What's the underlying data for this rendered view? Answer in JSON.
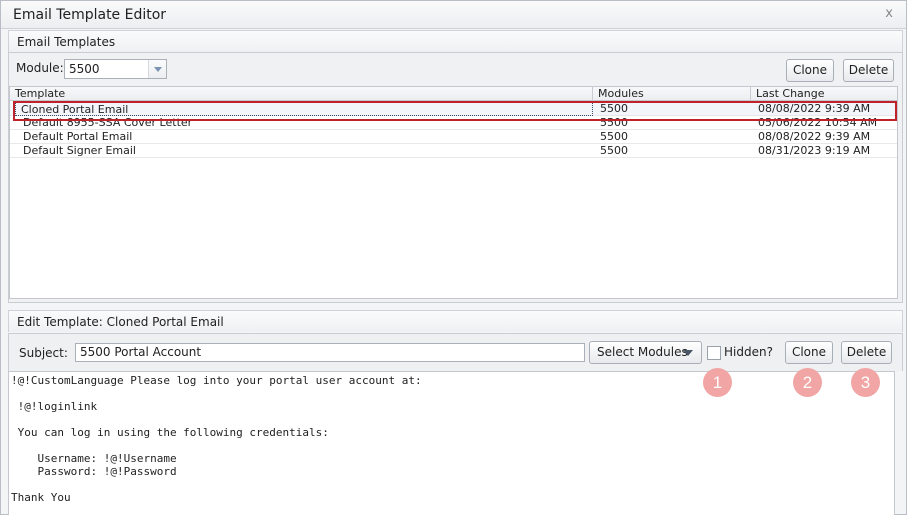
{
  "window": {
    "title": "Email Template Editor",
    "close_glyph": "x"
  },
  "templates_section": {
    "title": "Email Templates",
    "module_label": "Module:",
    "module_value": "5500",
    "clone_label": "Clone",
    "delete_label": "Delete"
  },
  "grid": {
    "columns": [
      "Template",
      "Modules",
      "Last Change"
    ],
    "rows": [
      {
        "template": "Cloned Portal Email",
        "modules": "5500",
        "last_change": "08/08/2022 9:39 AM"
      },
      {
        "template": "Default 8955-SSA Cover Letter",
        "modules": "5500",
        "last_change": "05/06/2022 10:54 AM"
      },
      {
        "template": "Default Portal Email",
        "modules": "5500",
        "last_change": "08/08/2022 9:39 AM"
      },
      {
        "template": "Default Signer Email",
        "modules": "5500",
        "last_change": "08/31/2023 9:19 AM"
      }
    ],
    "selected_row": 0
  },
  "edit_section": {
    "title": "Edit Template: Cloned Portal Email",
    "subject_label": "Subject:",
    "subject_value": "5500 Portal Account",
    "select_modules_label": "Select Modules",
    "hidden_label": "Hidden?",
    "hidden_checked": false,
    "clone_label": "Clone",
    "delete_label": "Delete"
  },
  "editor_lines": [
    "!@!CustomLanguage Please log into your portal user account at:",
    " !@!loginlink",
    " You can log in using the following credentials:",
    "    Username: !@!Username",
    "    Password: !@!Password",
    "Thank You"
  ],
  "callouts": [
    "1",
    "2",
    "3"
  ],
  "colors": {
    "highlight": "#c0222b",
    "callout": "#f1a5a5",
    "dropdown_arrow": "#7b93b0"
  }
}
